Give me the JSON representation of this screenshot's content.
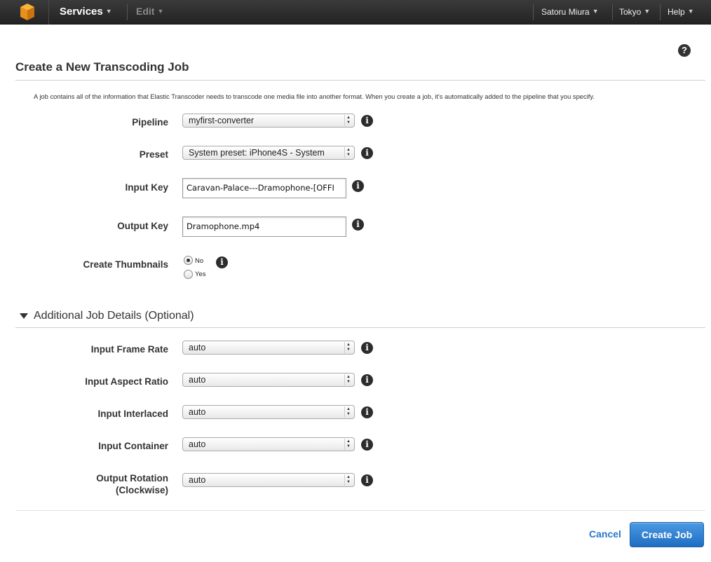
{
  "navbar": {
    "logo_icon": "aws-cube-icon",
    "services_label": "Services",
    "edit_label": "Edit",
    "user_label": "Satoru Miura",
    "region_label": "Tokyo",
    "help_label": "Help",
    "caret_glyph": "▼"
  },
  "page": {
    "title": "Create a New Transcoding Job",
    "help_glyph": "?",
    "description": "A job contains all of the information that Elastic Transcoder needs to transcode one media file into another format. When you create a job, it's automatically added to the pipeline that you specify."
  },
  "form": {
    "pipeline": {
      "label": "Pipeline",
      "value": "myfirst-converter"
    },
    "preset": {
      "label": "Preset",
      "value": "System preset: iPhone4S - System"
    },
    "input_key": {
      "label": "Input Key",
      "value": "Caravan-Palace---Dramophone-[OFFI"
    },
    "output_key": {
      "label": "Output Key",
      "value": "Dramophone.mp4"
    },
    "thumbnails": {
      "label": "Create Thumbnails",
      "options": [
        "No",
        "Yes"
      ],
      "selected": "No"
    }
  },
  "additional": {
    "title": "Additional Job Details (Optional)",
    "frame_rate": {
      "label": "Input Frame Rate",
      "value": "auto"
    },
    "aspect_ratio": {
      "label": "Input Aspect Ratio",
      "value": "auto"
    },
    "interlaced": {
      "label": "Input Interlaced",
      "value": "auto"
    },
    "container": {
      "label": "Input Container",
      "value": "auto"
    },
    "rotation": {
      "label_line1": "Output Rotation",
      "label_line2": "(Clockwise)",
      "value": "auto"
    }
  },
  "info_glyph": "i",
  "select_arrows": "▲▼",
  "actions": {
    "cancel_label": "Cancel",
    "create_label": "Create Job"
  },
  "colors": {
    "navbar_bg": "#2b2b2b",
    "logo_orange": "#f7a41d",
    "primary_button": "#2a77c9",
    "link": "#2a77c9"
  }
}
